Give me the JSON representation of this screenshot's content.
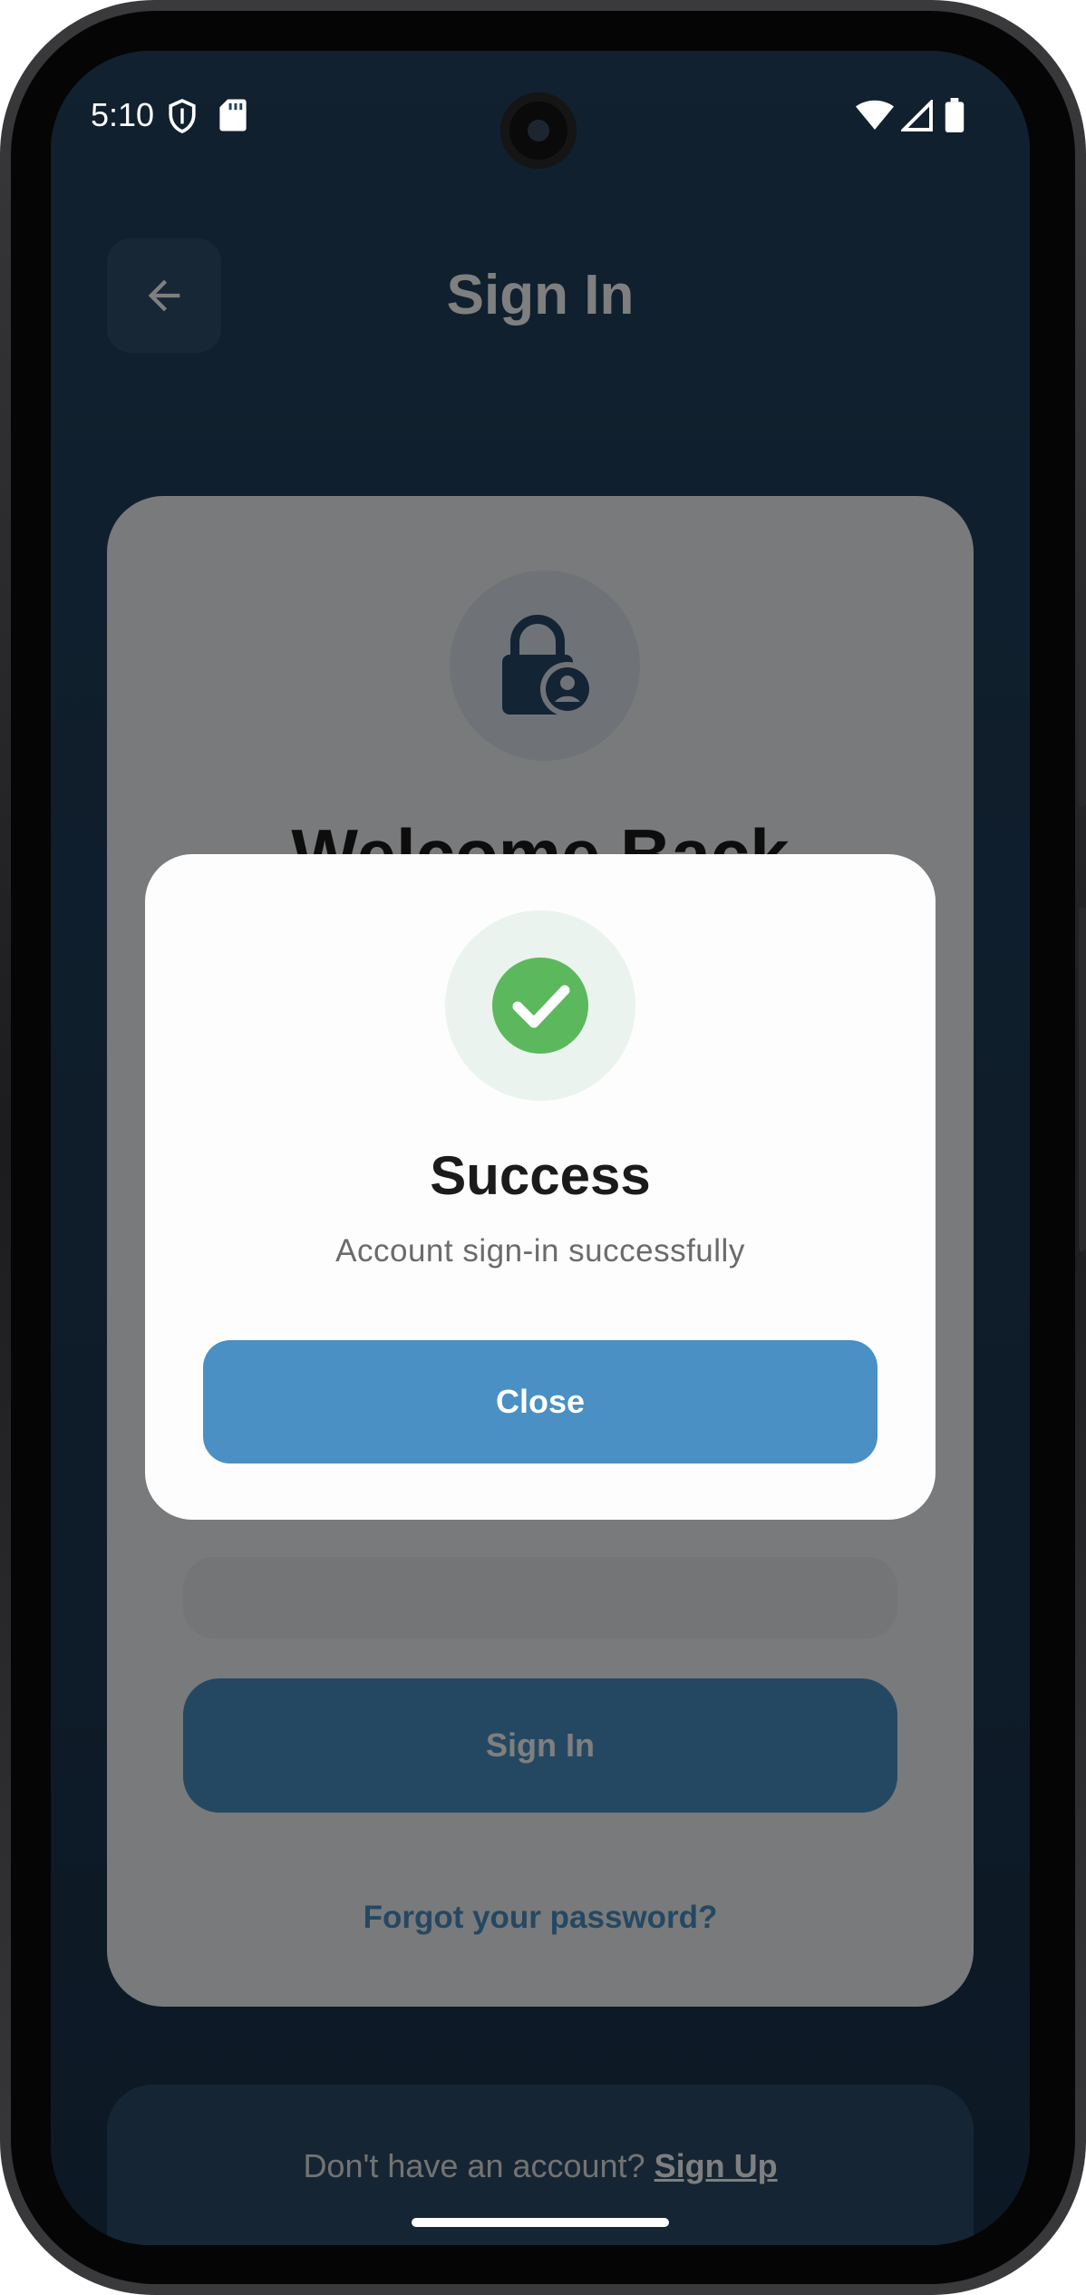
{
  "status_bar": {
    "time": "5:10",
    "left_icons": [
      "shield-icon",
      "sd-card-icon"
    ],
    "right_icons": [
      "wifi-icon",
      "signal-icon",
      "battery-icon"
    ]
  },
  "header": {
    "title": "Sign In",
    "back_icon": "arrow-left-icon"
  },
  "card": {
    "icon": "lock-person-icon",
    "heading": "Welcome Back",
    "signin_label": "Sign In",
    "forgot_label": "Forgot your password?"
  },
  "footer": {
    "prompt": "Don't have an account? ",
    "signup_label": "Sign Up"
  },
  "dialog": {
    "icon": "check-circle-icon",
    "title": "Success",
    "message": "Account sign-in successfully",
    "close_label": "Close"
  },
  "colors": {
    "primary": "#4a90c4",
    "success": "#5cb85c",
    "background": "#22425e"
  }
}
